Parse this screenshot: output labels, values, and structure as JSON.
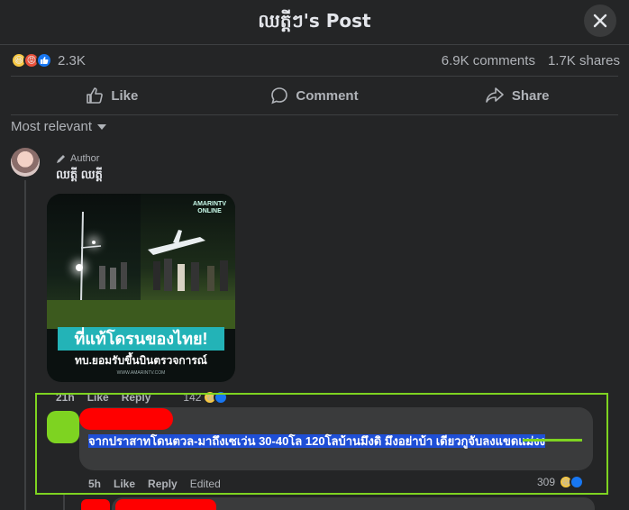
{
  "header": {
    "title": "ឈត្តីៗ's Post"
  },
  "stats": {
    "reactions": [
      "laughing-emoji",
      "angry-emoji",
      "like-icon"
    ],
    "reaction_count": "2.3K",
    "comments": "6.9K comments",
    "shares": "1.7K shares"
  },
  "actions": {
    "like": "Like",
    "comment": "Comment",
    "share": "Share"
  },
  "sort": {
    "label": "Most relevant"
  },
  "comment": {
    "badge": "Author",
    "author": "ឈត្តី ឈត្តី",
    "image": {
      "brand_line1": "AMARINTV",
      "brand_line2": "ONLINE",
      "headline": "ที่แท้โดรนของไทย!",
      "subhead": "ทบ.ยอมรับขึ้นบินตรวจการณ์",
      "site": "WWW.AMARINTV.COM"
    },
    "meta": {
      "time": "21h",
      "like": "Like",
      "reply": "Reply",
      "reaction_count": "142"
    }
  },
  "reply": {
    "text": "จากปราสาทโดนตวล-มาถึงเซเว่น 30-40โล 120โลบ้านมึงดิ มึงอย่าบ้า เดียวกูจับลงแขดแม่งง",
    "meta": {
      "time": "5h",
      "like": "Like",
      "reply": "Reply",
      "edited": "Edited",
      "reaction_count": "309"
    }
  },
  "colors": {
    "background": "#242526",
    "bubble": "#3a3b3c",
    "highlight": "#7ed321",
    "redaction": "#ff0000",
    "selection": "#1f4fd6"
  }
}
